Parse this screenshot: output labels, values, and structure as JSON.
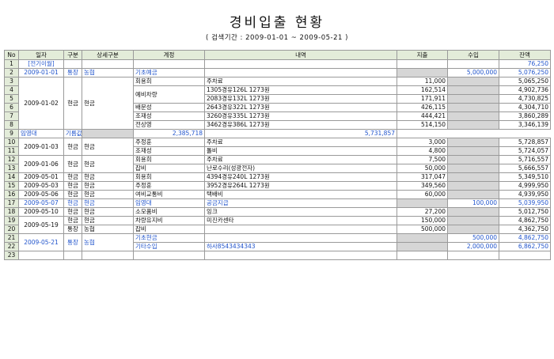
{
  "title": "경비입출 현황",
  "subtitle": "( 검색기간 : 2009-01-01 ~ 2009-05-21 )",
  "columns": [
    "No",
    "일자",
    "구분",
    "상세구분",
    "계정",
    "내역",
    "지출",
    "수입",
    "잔액"
  ],
  "rows": [
    {
      "no": "1",
      "date": "[전기이월]",
      "div": "",
      "detail": "",
      "account": "",
      "desc": "",
      "exp": "",
      "inc": "",
      "bal": "76,250",
      "blue": true
    },
    {
      "no": "2",
      "date": "2009-01-01",
      "div": "통장",
      "detail": "농협",
      "account": "기초예금",
      "desc": "",
      "exp": "",
      "inc": "5,000,000",
      "bal": "5,076,250",
      "blue": true
    },
    {
      "no": "3",
      "date": "",
      "div": "",
      "detail": "",
      "account": "회용희",
      "desc": "주차료",
      "exp": "11,000",
      "inc": "",
      "bal": "5,065,250",
      "blue": false
    },
    {
      "no": "4",
      "date": "",
      "div": "",
      "detail": "",
      "account": "",
      "desc": "1305경유126L 1273원",
      "exp": "162,514",
      "inc": "",
      "bal": "4,902,736",
      "blue": false
    },
    {
      "no": "5",
      "date": "",
      "div": "",
      "detail": "",
      "account": "",
      "desc": "2083경유132L 1273원",
      "exp": "171,911",
      "inc": "",
      "bal": "4,730,825",
      "blue": false
    },
    {
      "no": "6",
      "date": "",
      "div": "",
      "detail": "",
      "account": "배문성",
      "desc": "2643경유322L 1273원",
      "exp": "426,115",
      "inc": "",
      "bal": "4,304,710",
      "blue": false
    },
    {
      "no": "7",
      "date": "",
      "div": "",
      "detail": "",
      "account": "조재성",
      "desc": "3260경유335L 1273원",
      "exp": "444,421",
      "inc": "",
      "bal": "3,860,289",
      "blue": false
    },
    {
      "no": "8",
      "date": "",
      "div": "",
      "detail": "",
      "account": "전상영",
      "desc": "3462경유386L 1273원",
      "exp": "514,150",
      "inc": "",
      "bal": "3,346,139",
      "blue": false
    },
    {
      "no": "9",
      "date": "",
      "div": "",
      "detail": "",
      "account": "임영대",
      "desc": "기름값지급",
      "exp": "",
      "inc": "2,385,718",
      "bal": "5,731,857",
      "blue": true
    },
    {
      "no": "10",
      "date": "",
      "div": "",
      "detail": "",
      "account": "주정훈",
      "desc": "주차료",
      "exp": "3,000",
      "inc": "",
      "bal": "5,728,857",
      "blue": false
    },
    {
      "no": "11",
      "date": "",
      "div": "",
      "detail": "",
      "account": "조재성",
      "desc": "톨비",
      "exp": "4,800",
      "inc": "",
      "bal": "5,724,057",
      "blue": false
    },
    {
      "no": "12",
      "date": "",
      "div": "",
      "detail": "",
      "account": "회용희",
      "desc": "주차료",
      "exp": "7,500",
      "inc": "",
      "bal": "5,716,557",
      "blue": false
    },
    {
      "no": "13",
      "date": "",
      "div": "",
      "detail": "",
      "account": "잡비",
      "desc": "난로수리(성광전자)",
      "exp": "50,000",
      "inc": "",
      "bal": "5,666,557",
      "blue": false
    },
    {
      "no": "14",
      "date": "2009-05-01",
      "div": "현금",
      "detail": "현금",
      "account": "회용희",
      "desc": "4394경유240L 1273원",
      "exp": "317,047",
      "inc": "",
      "bal": "5,349,510",
      "blue": false
    },
    {
      "no": "15",
      "date": "2009-05-03",
      "div": "현금",
      "detail": "현금",
      "account": "주정훈",
      "desc": "3952경유264L 1273원",
      "exp": "349,560",
      "inc": "",
      "bal": "4,999,950",
      "blue": false
    },
    {
      "no": "16",
      "date": "2009-05-06",
      "div": "현금",
      "detail": "현금",
      "account": "여비교통비",
      "desc": "택배비",
      "exp": "60,000",
      "inc": "",
      "bal": "4,939,950",
      "blue": false
    },
    {
      "no": "17",
      "date": "2009-05-07",
      "div": "현금",
      "detail": "현금",
      "account": "임영대",
      "desc": "공금지급",
      "exp": "",
      "inc": "100,000",
      "bal": "5,039,950",
      "blue": true
    },
    {
      "no": "18",
      "date": "2009-05-10",
      "div": "현금",
      "detail": "현금",
      "account": "소모품비",
      "desc": "잉크",
      "exp": "27,200",
      "inc": "",
      "bal": "5,012,750",
      "blue": false
    },
    {
      "no": "19",
      "date": "",
      "div": "현금",
      "detail": "현금",
      "account": "차량유지비",
      "desc": "미진카센타",
      "exp": "150,000",
      "inc": "",
      "bal": "4,862,750",
      "blue": false
    },
    {
      "no": "20",
      "date": "",
      "div": "통장",
      "detail": "농협",
      "account": "잡비",
      "desc": "",
      "exp": "500,000",
      "inc": "",
      "bal": "4,362,750",
      "blue": false
    },
    {
      "no": "21",
      "date": "",
      "div": "현금",
      "detail": "현금",
      "account": "기초현금",
      "desc": "",
      "exp": "",
      "inc": "500,000",
      "bal": "4,862,750",
      "blue": true
    },
    {
      "no": "22",
      "date": "",
      "div": "",
      "detail": "",
      "account": "기타수입",
      "desc": "하사8543434343",
      "exp": "",
      "inc": "2,000,000",
      "bal": "6,862,750",
      "blue": true
    },
    {
      "no": "23",
      "date": "",
      "div": "",
      "detail": "",
      "account": "",
      "desc": "",
      "exp": "",
      "inc": "",
      "bal": "",
      "blue": false
    }
  ],
  "merged": {
    "date_0102": "2009-01-02",
    "div_0102": "현금",
    "detail_0102": "현금",
    "account_r4_5": "예비차량",
    "date_0103": "2009-01-03",
    "div_0103": "현금",
    "detail_0103": "현금",
    "date_0106": "2009-01-06",
    "div_0106": "현금",
    "detail_0106": "현금",
    "date_0519": "2009-05-19",
    "date_0521": "2009-05-21",
    "div_0521": "통장",
    "detail_0521": "농협"
  }
}
